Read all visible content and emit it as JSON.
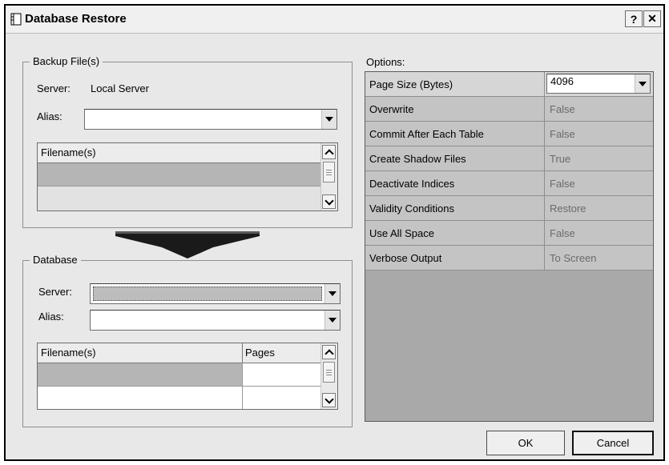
{
  "window": {
    "title": "Database Restore",
    "help_label": "?",
    "close_label": "✕"
  },
  "backup": {
    "legend": "Backup File(s)",
    "server_label": "Server:",
    "server_value": "Local Server",
    "alias_label": "Alias:",
    "alias_value": "",
    "grid_header": "Filename(s)"
  },
  "database": {
    "legend": "Database",
    "server_label": "Server:",
    "alias_label": "Alias:",
    "alias_value": "",
    "grid_headers": [
      "Filename(s)",
      "Pages"
    ]
  },
  "options": {
    "label": "Options:",
    "page_size_label": "Page Size (Bytes)",
    "page_size_value": "4096",
    "rows": [
      {
        "name": "Overwrite",
        "value": "False"
      },
      {
        "name": "Commit After Each Table",
        "value": "False"
      },
      {
        "name": "Create Shadow Files",
        "value": "True"
      },
      {
        "name": "Deactivate Indices",
        "value": "False"
      },
      {
        "name": "Validity Conditions",
        "value": "Restore"
      },
      {
        "name": "Use All Space",
        "value": "False"
      },
      {
        "name": "Verbose Output",
        "value": "To Screen"
      }
    ]
  },
  "buttons": {
    "ok": "OK",
    "cancel": "Cancel"
  },
  "icons": {
    "app": "database-restore-icon",
    "flow": "arrow-down-icon"
  }
}
